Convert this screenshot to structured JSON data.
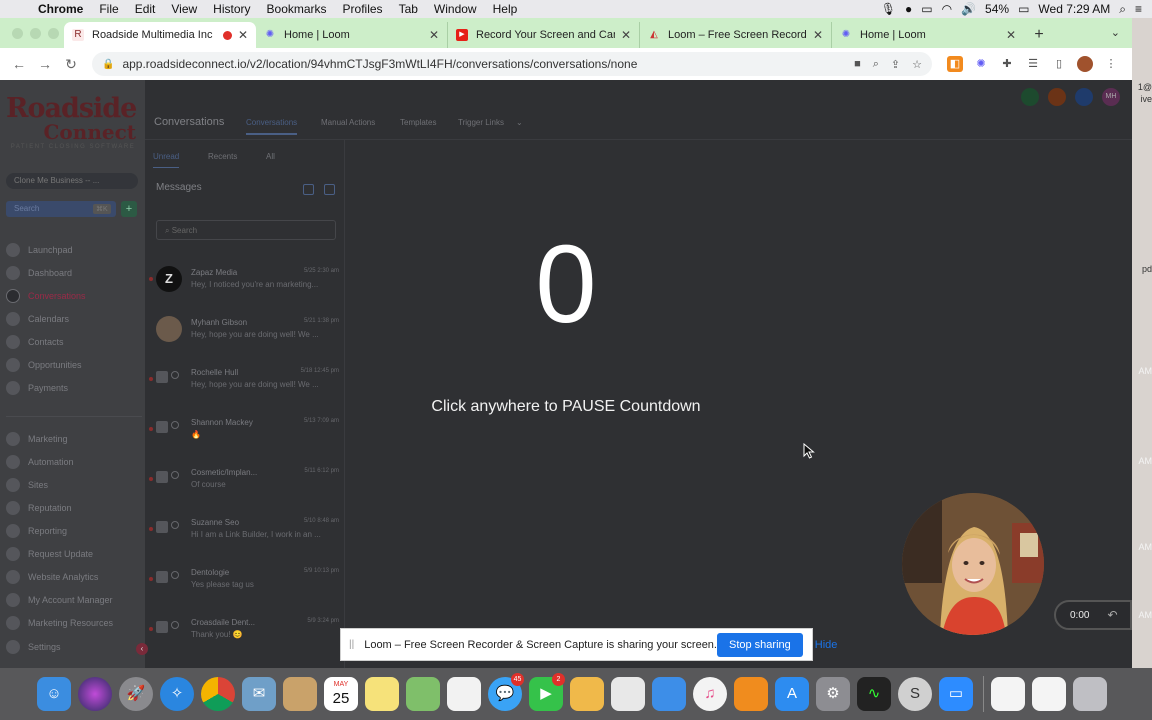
{
  "menubar": {
    "app": "Chrome",
    "items": [
      "File",
      "Edit",
      "View",
      "History",
      "Bookmarks",
      "Profiles",
      "Tab",
      "Window",
      "Help"
    ],
    "battery": "54%",
    "clock": "Wed 7:29 AM"
  },
  "tabs": [
    {
      "title": "Roadside Multimedia Inc"
    },
    {
      "title": "Home | Loom"
    },
    {
      "title": "Record Your Screen and Came"
    },
    {
      "title": "Loom – Free Screen Recorder"
    },
    {
      "title": "Home | Loom"
    }
  ],
  "address": {
    "url": "app.roadsideconnect.io/v2/location/94vhmCTJsgF3mWtLI4FH/conversations/conversations/none"
  },
  "logo": {
    "line1": "Roadside",
    "line2": "Connect",
    "tagline": "PATIENT CLOSING SOFTWARE"
  },
  "sidebar": {
    "account": "Clone Me Business -- ...",
    "search": "Search",
    "shortcut": "⌘K",
    "nav1": [
      "Launchpad",
      "Dashboard",
      "Conversations",
      "Calendars",
      "Contacts",
      "Opportunities",
      "Payments"
    ],
    "nav2": [
      "Marketing",
      "Automation",
      "Sites",
      "Reputation",
      "Reporting",
      "Request Update",
      "Website Analytics",
      "My Account Manager",
      "Marketing Resources"
    ],
    "settings": "Settings"
  },
  "topnav": {
    "title": "Conversations",
    "tabs": [
      "Conversations",
      "Manual Actions",
      "Templates",
      "Trigger Links"
    ],
    "avatar_initials": "MH"
  },
  "messages": {
    "subtabs": [
      "Unread",
      "Recents",
      "All"
    ],
    "heading": "Messages",
    "search_placeholder": "Search",
    "items": [
      {
        "name": "Zapaz Media",
        "date": "5/25 2:30 am",
        "preview": "Hey, I noticed you're an marketing..."
      },
      {
        "name": "Myhanh Gibson",
        "date": "5/21 1:38 pm",
        "preview": "Hey, hope you are doing well! We ..."
      },
      {
        "name": "Rochelle Hull",
        "date": "5/18 12:45 pm",
        "preview": "Hey, hope you are doing well! We ..."
      },
      {
        "name": "Shannon Mackey",
        "date": "5/13 7:09 am",
        "preview": "🔥"
      },
      {
        "name": "Cosmetic/Implan...",
        "date": "5/11 6:12 pm",
        "preview": "Of course"
      },
      {
        "name": "Suzanne Seo",
        "date": "5/10 8:48 am",
        "preview": "Hi I am a Link Builder, I work in an ..."
      },
      {
        "name": "Dentologie",
        "date": "5/9 10:13 pm",
        "preview": "Yes please tag us"
      },
      {
        "name": "Croasdaile Dent...",
        "date": "5/9 3:24 pm",
        "preview": "Thank you! 😊"
      }
    ]
  },
  "overlay": {
    "countdown": "0",
    "hint": "Click anywhere to PAUSE Countdown",
    "timer": "0:00"
  },
  "sharebar": {
    "message": "Loom – Free Screen Recorder & Screen Capture is sharing your screen.",
    "stop": "Stop sharing",
    "hide": "Hide"
  },
  "dock": {
    "calendar_month": "MAY",
    "calendar_day": "25",
    "badges": {
      "messages": "45",
      "facetime": "2"
    }
  },
  "rightstrip": [
    "1@",
    "ive",
    "pd",
    "AM",
    "AM",
    "AM",
    "AM"
  ],
  "colors": {
    "tabbar": "#cdeec9",
    "accent": "#1a73e8",
    "brand": "#5a2226"
  }
}
